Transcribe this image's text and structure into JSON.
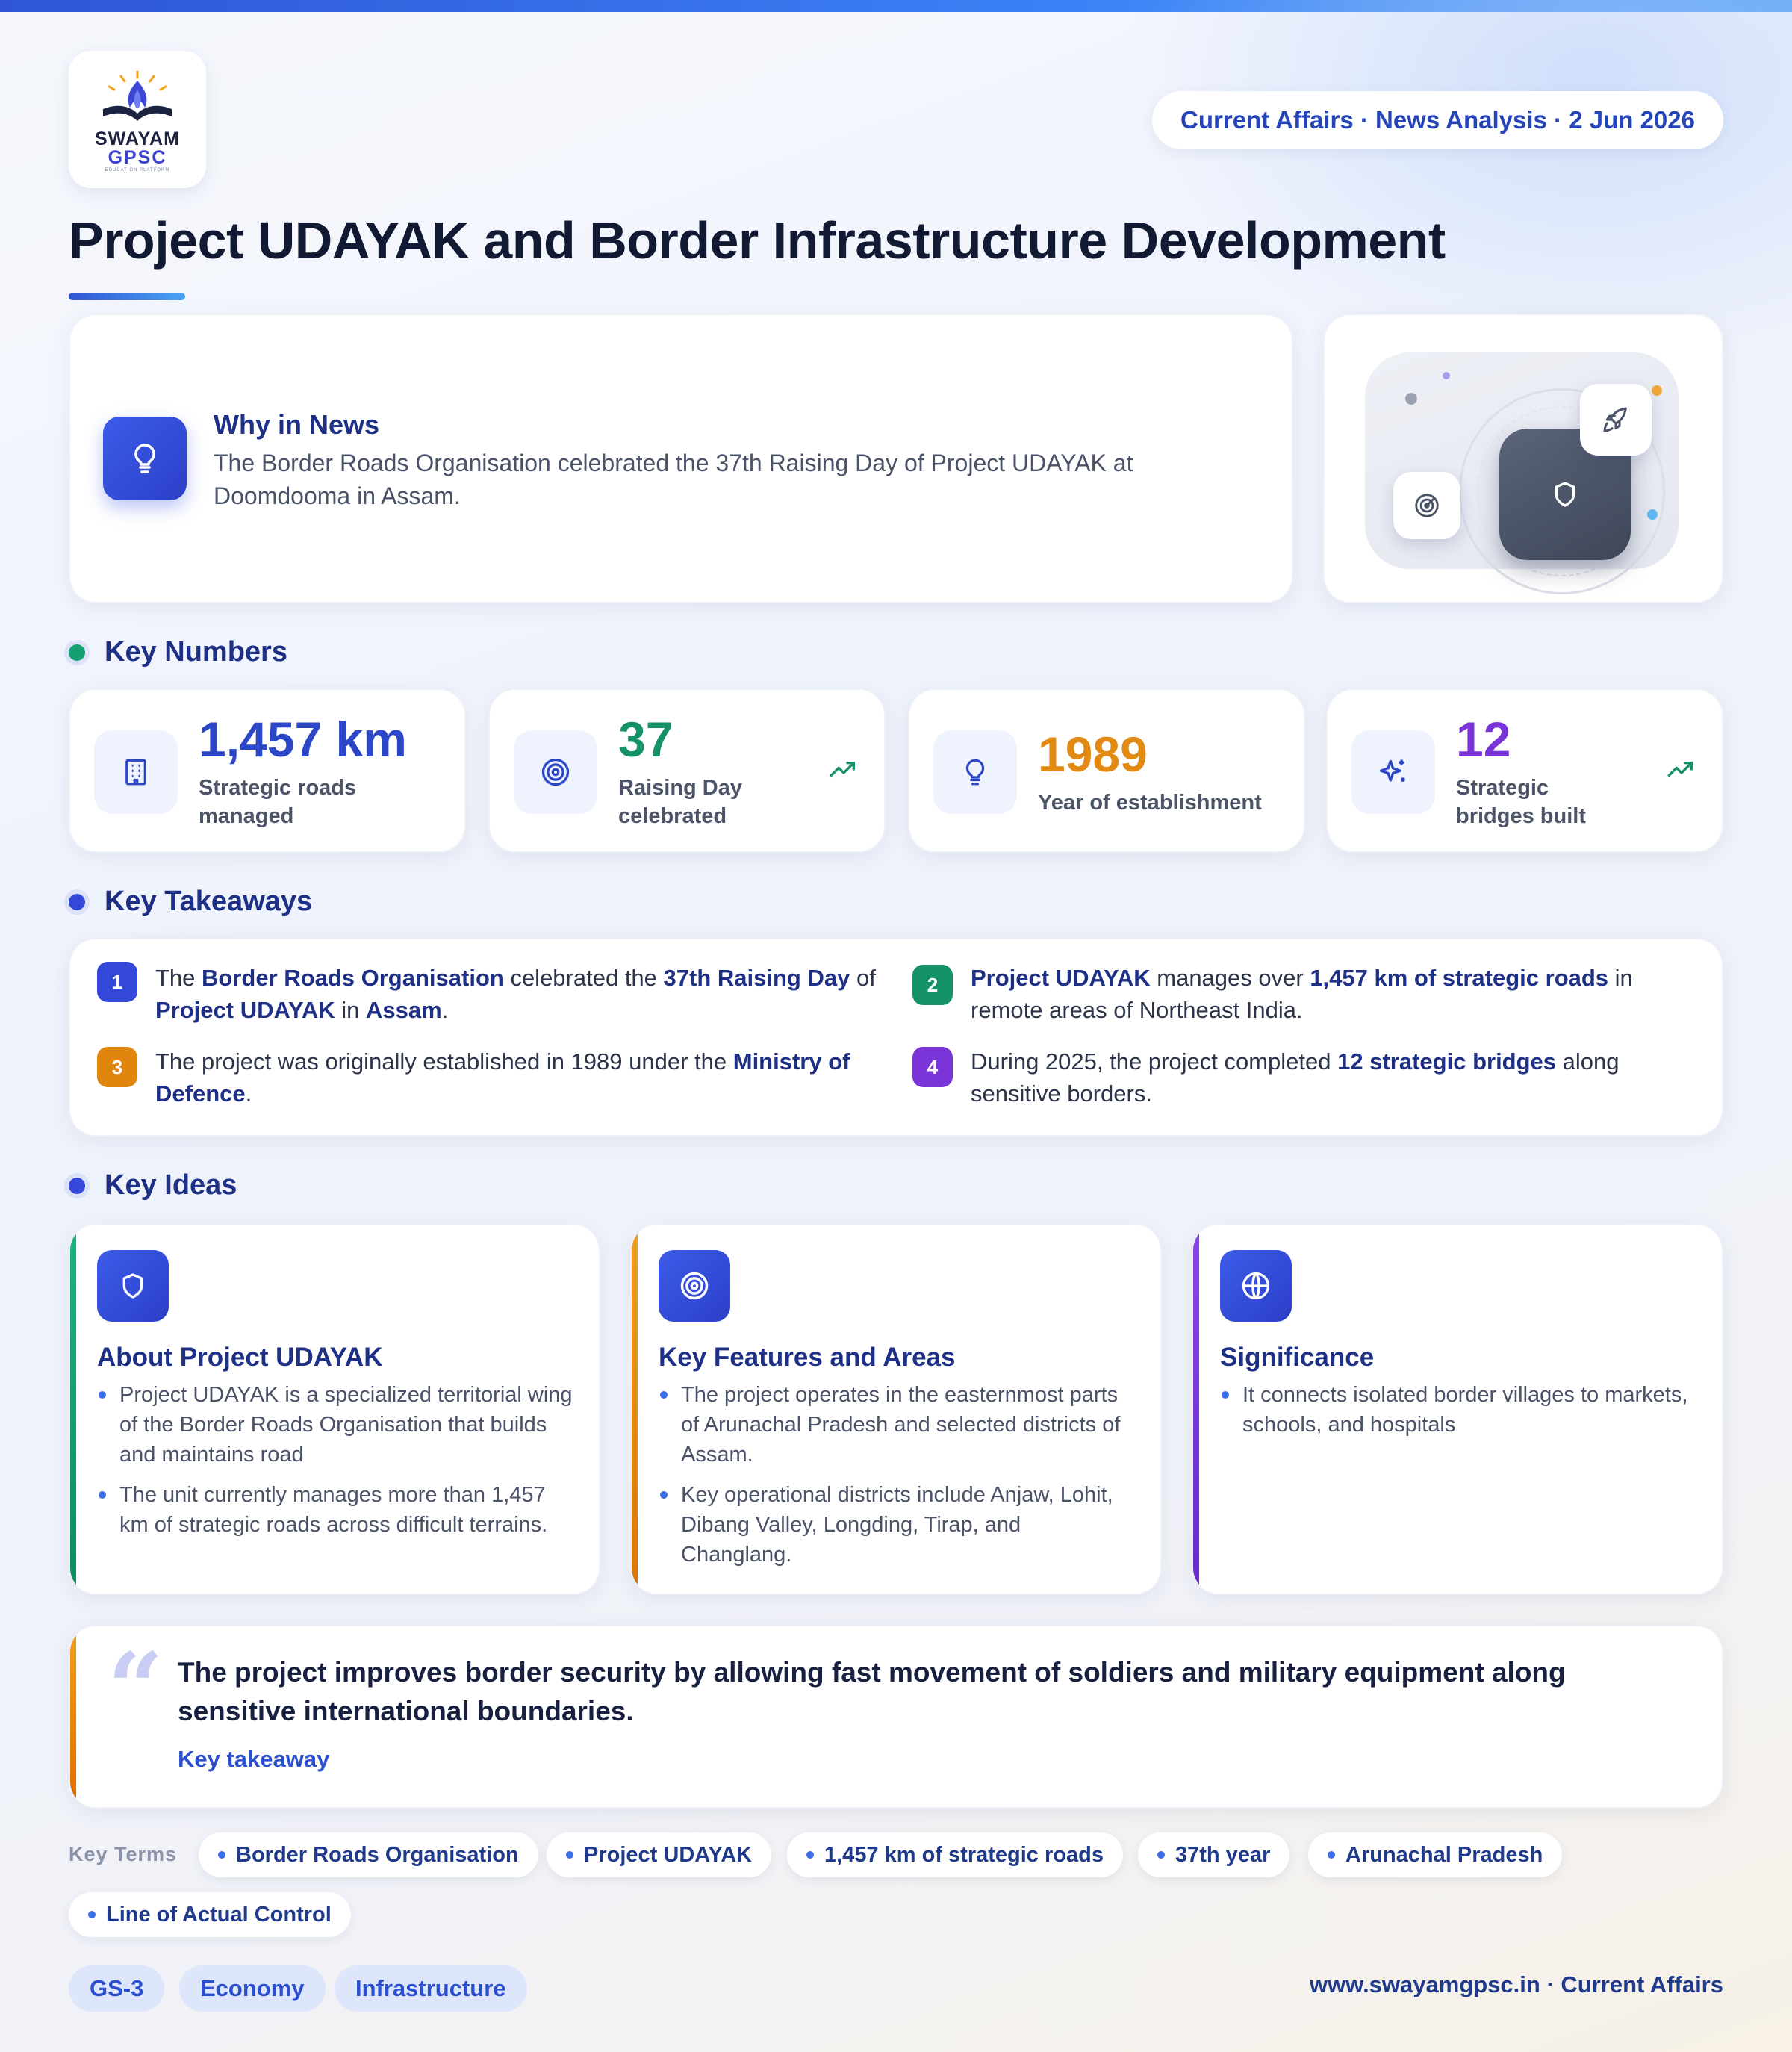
{
  "header": {
    "logo": {
      "word1": "SWAYAM",
      "word2": "GPSC",
      "tagline": "EDUCATION PLATFORM"
    },
    "meta_pill": "Current Affairs · News Analysis · 2 Jun 2026",
    "title": "Project UDAYAK and Border Infrastructure Development"
  },
  "why": {
    "heading": "Why in News",
    "text": "The Border Roads Organisation celebrated the 37th Raising Day of Project UDAYAK at Doomdooma in Assam."
  },
  "illustration": {
    "icons": [
      "shield-icon",
      "rocket-icon",
      "radar-icon"
    ]
  },
  "key_numbers": {
    "heading": "Key Numbers",
    "items": [
      {
        "value": "1,457 km",
        "label": "Strategic roads managed",
        "icon": "building-icon",
        "color": "#2c46c8",
        "trend": false
      },
      {
        "value": "37",
        "label": "Raising Day celebrated",
        "icon": "target-icon",
        "color": "#149168",
        "trend": true
      },
      {
        "value": "1989",
        "label": "Year of establishment",
        "icon": "lightbulb-icon",
        "color": "#e28a12",
        "trend": false
      },
      {
        "value": "12",
        "label": "Strategic bridges built",
        "icon": "sparkles-icon",
        "color": "#7a35d8",
        "trend": true
      }
    ]
  },
  "takeaways": {
    "heading": "Key Takeaways",
    "items": [
      {
        "n": "1",
        "color": "#3348d8",
        "parts": [
          [
            "",
            "The "
          ],
          [
            "b",
            "Border Roads Organisation"
          ],
          [
            "",
            " celebrated the "
          ],
          [
            "b",
            "37th Raising Day"
          ],
          [
            "",
            " of "
          ],
          [
            "b",
            "Project UDAYAK"
          ],
          [
            "",
            " in "
          ],
          [
            "b",
            "Assam"
          ],
          [
            "",
            "."
          ]
        ]
      },
      {
        "n": "2",
        "color": "#149168",
        "parts": [
          [
            "b",
            "Project UDAYAK"
          ],
          [
            "",
            " manages over "
          ],
          [
            "b",
            "1,457 km of strategic roads"
          ],
          [
            "",
            " in remote areas of Northeast India."
          ]
        ]
      },
      {
        "n": "3",
        "color": "#e0860e",
        "parts": [
          [
            "",
            "The project was originally established in 1989 under the "
          ],
          [
            "b",
            "Ministry of Defence"
          ],
          [
            "",
            "."
          ]
        ]
      },
      {
        "n": "4",
        "color": "#7a35d8",
        "parts": [
          [
            "",
            "During 2025, the project completed "
          ],
          [
            "b",
            "12 strategic bridges"
          ],
          [
            "",
            " along sensitive borders."
          ]
        ]
      }
    ]
  },
  "ideas": {
    "heading": "Key Ideas",
    "cards": [
      {
        "title": "About Project UDAYAK",
        "icon": "shield-icon",
        "accent": "#14a070",
        "points": [
          "Project UDAYAK is a specialized territorial wing of the Border Roads Organisation that builds and maintains road",
          "The unit currently manages more than 1,457 km of strategic roads across difficult terrains."
        ]
      },
      {
        "title": "Key Features and Areas",
        "icon": "target-icon",
        "accent": "#e58a12",
        "points": [
          "The project operates in the easternmost parts of Arunachal Pradesh and selected districts of Assam.",
          "Key operational districts include Anjaw, Lohit, Dibang Valley, Longding, Tirap, and Changlang."
        ]
      },
      {
        "title": "Significance",
        "icon": "globe-icon",
        "accent": "#7a35d8",
        "points": [
          "It connects isolated border villages to markets, schools, and hospitals"
        ]
      }
    ]
  },
  "quote": {
    "text": "The project improves border security by allowing fast movement of soldiers and military equipment along sensitive international boundaries.",
    "label": "Key takeaway"
  },
  "key_terms": {
    "label": "Key Terms",
    "items": [
      "Border Roads Organisation",
      "Project UDAYAK",
      "1,457 km of strategic roads",
      "37th year",
      "Arunachal Pradesh",
      "Line of Actual Control"
    ]
  },
  "tags": [
    "GS-3",
    "Economy",
    "Infrastructure"
  ],
  "footer": "www.swayamgpsc.in · Current Affairs"
}
